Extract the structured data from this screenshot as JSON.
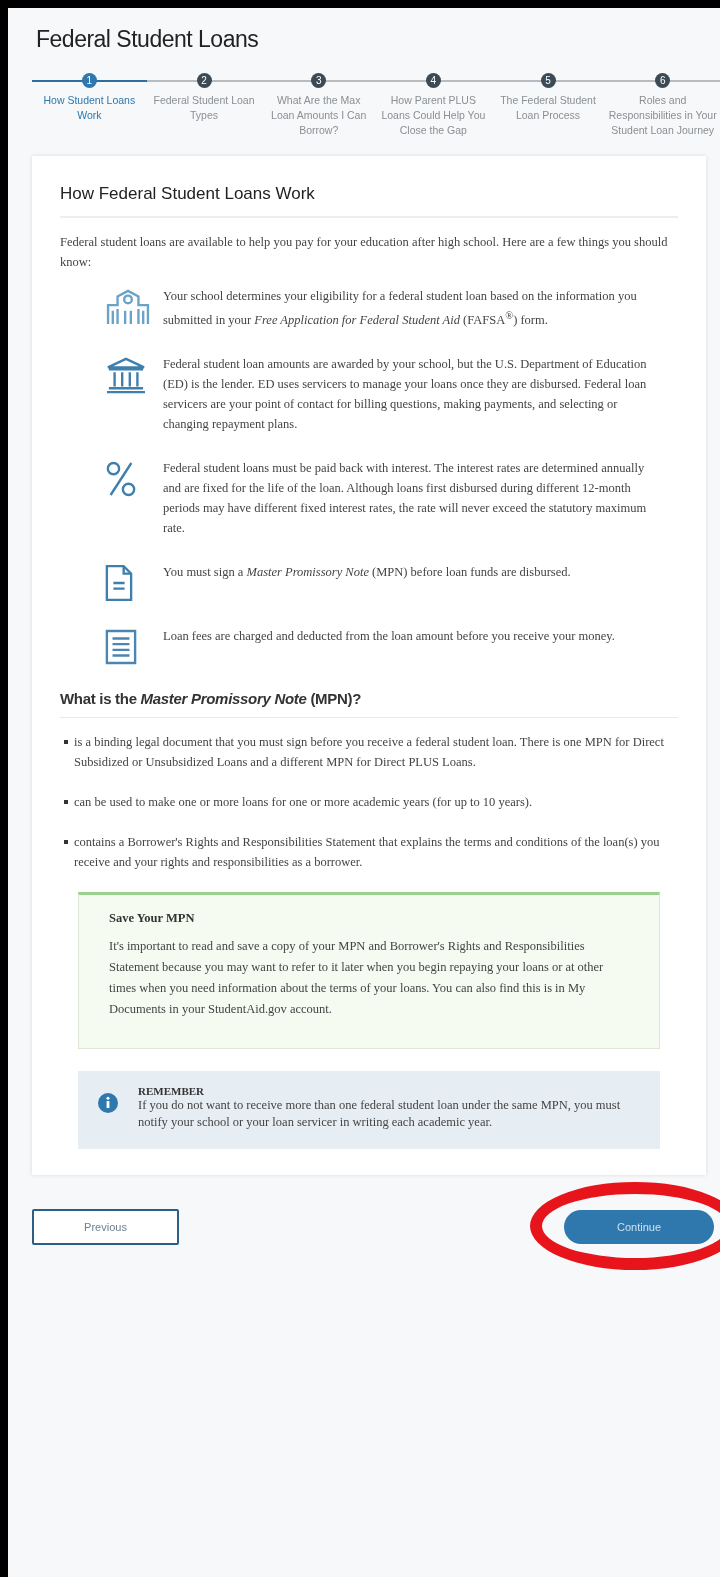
{
  "page_title": "Federal Student Loans",
  "steps": [
    {
      "number": "1",
      "label": "How Student Loans Work",
      "selected": true
    },
    {
      "number": "2",
      "label": "Federal Student Loan Types",
      "selected": false
    },
    {
      "number": "3",
      "label": "What Are the Max Loan Amounts I Can Borrow?",
      "selected": false
    },
    {
      "number": "4",
      "label": "How Parent PLUS Loans Could Help You Close the Gap",
      "selected": false
    },
    {
      "number": "5",
      "label": "The Federal Student Loan Process",
      "selected": false
    },
    {
      "number": "6",
      "label": "Roles and Responsibilities in Your Student Loan Journey",
      "selected": false
    }
  ],
  "card": {
    "heading": "How Federal Student Loans Work",
    "intro": "Federal student loans are available to help you pay for your education after high school. Here are a few things you should know:",
    "facts": [
      {
        "kind": "school",
        "text": "Your school determines your eligibility for a federal student loan based on the information you submitted in your *Free Application for Federal Student Aid* (FAFSA$^{®}$) form."
      },
      {
        "kind": "bank",
        "text": "Federal student loan amounts are awarded by your school, but the U.S. Department of Education (ED) is the lender.  ED uses servicers to manage your loans once they are disbursed. Federal loan servicers are your point of contact for billing questions, making payments, and selecting or changing repayment plans."
      },
      {
        "kind": "percent",
        "text": "Federal student loans must be paid back with interest. The interest rates are determined annually and are fixed for the life of the loan.  Although loans first disbursed during different 12-month periods may have different fixed interest rates, the rate will never exceed the statutory maximum rate."
      },
      {
        "kind": "document",
        "text": "You must sign a *Master Promissory Note* (MPN) before loan funds are disbursed."
      },
      {
        "kind": "list",
        "text": "Loan fees are charged and deducted from the loan amount before you receive your money."
      }
    ],
    "mpn_heading": "What is the *Master Promissory Note* (MPN)?",
    "mpn_points": [
      "is a binding legal document that you must sign before you receive a federal student loan. There is one MPN for Direct Subsidized or Unsubsidized Loans and a different MPN for Direct PLUS Loans.",
      "can be used to make one or more loans for one or more academic years (for up to 10 years).",
      "contains a Borrower's Rights and Responsibilities Statement that explains the terms and conditions of the loan(s) you receive and your rights and responsibilities as a borrower."
    ],
    "save_box": {
      "title": "Save Your MPN",
      "text": "It's important to read and save a copy of your MPN and Borrower's Rights and Responsibilities Statement because you may want to refer to it later when you begin repaying your loans or at other times when you need information about the terms of your loans. You can also find this is in My Documents in your StudentAid.gov account."
    },
    "remember_box": {
      "title": "REMEMBER",
      "text": "If you do not want to receive more than one federal student loan under the same MPN, you must notify your school or your loan servicer in writing each academic year."
    }
  },
  "buttons": {
    "previous": "Previous",
    "continue": "Continue"
  }
}
